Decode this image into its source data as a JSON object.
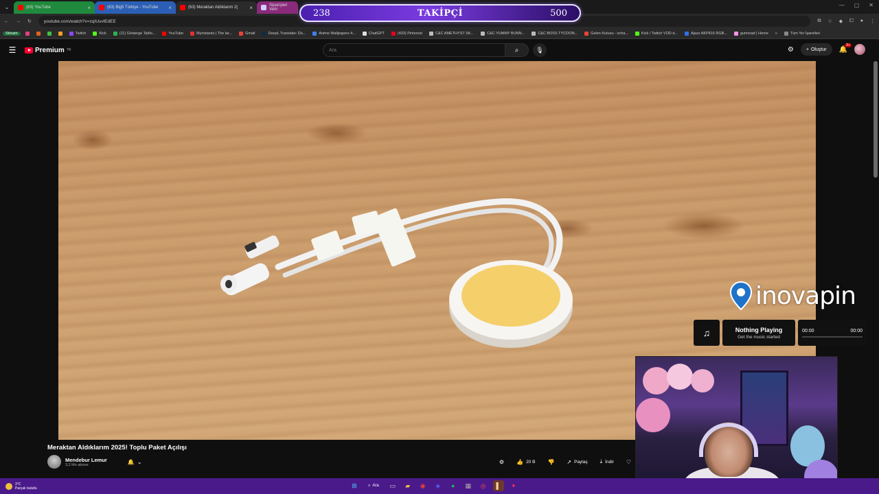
{
  "browser": {
    "tabs": [
      {
        "label": "(63) YouTube",
        "style": "green"
      },
      {
        "label": "(63) Big5 Türkiye - YouTube",
        "style": "blue"
      },
      {
        "label": "(63) Meraktan Aldıklarım 2(",
        "style": "active"
      },
      {
        "label": "Siparişleri Verir",
        "style": "pink"
      }
    ],
    "url": "youtube.com/watch?v=zqIUuvlEdEE",
    "bookmarks": [
      "Stream",
      "Twitch",
      "Kick",
      "(11) Gösterge Tablo...",
      "YouTube",
      "Myinstants | The lar...",
      "Gmail",
      "DeepL Translate: Dü...",
      "Anime Wallpapers 4...",
      "ChatGPT",
      "(433) Pinterest",
      "C&C AMETHYST SK...",
      "C&C YUMMY BUNN...",
      "C&C BOSS TYCOON...",
      "Gelen Kutusu - ocha...",
      "Kick / Twitch VOD d...",
      "Ajazz AKP815 RGB...",
      "gumroad | Home",
      "Tüm Yer İşaretleri"
    ]
  },
  "follower_goal": {
    "current": "238",
    "label": "TAKİPÇİ",
    "target": "500"
  },
  "youtube": {
    "brand": "Premium",
    "brand_sup": "TR",
    "search_placeholder": "Ara",
    "create_label": "Oluştur",
    "notif_count": "9+"
  },
  "video": {
    "title": "Meraktan Aldıklarım 2025! Toplu Paket Açılışı",
    "channel": "Mendebur Lemur",
    "subscribers": "3,2 Mn abone",
    "likes": "20 B",
    "share_label": "Paylaş",
    "download_label": "İndir"
  },
  "overlay": {
    "brand_word": "inovapin",
    "music_title": "Nothing Playing",
    "music_subtitle": "Get the music started",
    "time_start": "00:00",
    "time_end": "00:00"
  },
  "taskbar": {
    "temp": "3°C",
    "weather": "Parçalı bulutlu",
    "search_label": "Ara"
  }
}
